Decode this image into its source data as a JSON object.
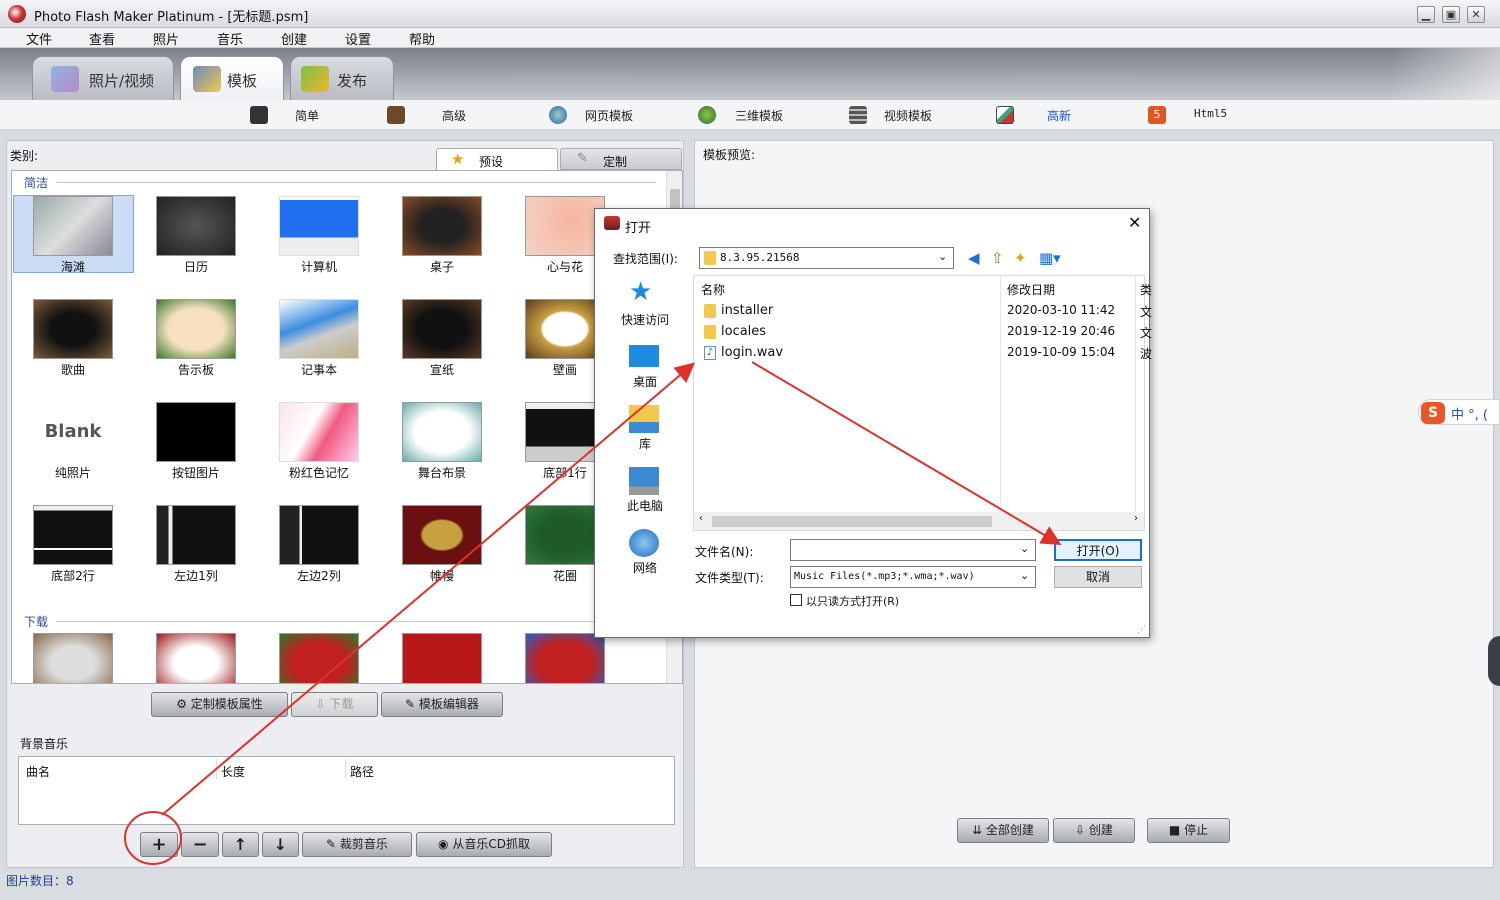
{
  "window": {
    "title": "Photo Flash Maker Platinum - [无标题.psm]",
    "min": "▁",
    "max": "▣",
    "close": "✕"
  },
  "menu": [
    "文件",
    "查看",
    "照片",
    "音乐",
    "创建",
    "设置",
    "帮助"
  ],
  "main_tabs": [
    {
      "label": "照片/视频",
      "icon": "photo-video-icon"
    },
    {
      "label": "模板",
      "icon": "template-icon"
    },
    {
      "label": "发布",
      "icon": "publish-icon"
    }
  ],
  "sub_tabs": [
    {
      "label": "简单",
      "icon": "piano-icon"
    },
    {
      "label": "高级",
      "icon": "briefcase-icon"
    },
    {
      "label": "网页模板",
      "icon": "globe-icon"
    },
    {
      "label": "三维模板",
      "icon": "molecule-icon"
    },
    {
      "label": "视频模板",
      "icon": "film-icon"
    },
    {
      "label": "高新",
      "icon": "picture-icon"
    },
    {
      "label": "Html5",
      "icon": "html5-icon"
    }
  ],
  "left": {
    "category_label": "类别:",
    "preset_tab": "预设",
    "custom_tab": "定制",
    "section_simple": "简洁",
    "section_download": "下载",
    "templates": [
      "海滩",
      "日历",
      "计算机",
      "桌子",
      "心与花",
      "歌曲",
      "告示板",
      "记事本",
      "宣纸",
      "壁画",
      "纯照片",
      "按钮图片",
      "粉红色记忆",
      "舞台布景",
      "底部1行",
      "底部2行",
      "左边1列",
      "左边2列",
      "帷幔",
      "花圈"
    ],
    "blank_text": "Blank",
    "btn_custom_props": "定制模板属性",
    "btn_download": "下载",
    "btn_editor": "模板编辑器",
    "bg_music_label": "背景音乐",
    "music_cols": [
      "曲名",
      "长度",
      "路径"
    ],
    "btn_add": "+",
    "btn_remove": "−",
    "btn_up": "↑",
    "btn_down": "↓",
    "btn_trim": "裁剪音乐",
    "btn_cd": "从音乐CD抓取"
  },
  "right": {
    "preview_label": "模板预览:",
    "btn_build_all": "全部创建",
    "btn_build": "创建",
    "btn_stop": "停止"
  },
  "status": {
    "photo_count": "图片数目：8"
  },
  "ime": {
    "text": "中 °, ("
  },
  "dialog": {
    "title": "打开",
    "lookin_label": "查找范围(I):",
    "lookin_value": "8.3.95.21568",
    "nav": [
      "快速访问",
      "桌面",
      "库",
      "此电脑",
      "网络"
    ],
    "col_name": "名称",
    "col_date": "修改日期",
    "col_extra": "类",
    "files": [
      {
        "name": "installer",
        "date": "2020-03-10 11:42",
        "type": "folder",
        "extra": "文"
      },
      {
        "name": "locales",
        "date": "2019-12-19 20:46",
        "type": "folder",
        "extra": "文"
      },
      {
        "name": "login.wav",
        "date": "2019-10-09 15:04",
        "type": "audio",
        "extra": "波"
      }
    ],
    "filename_label": "文件名(N):",
    "filename_value": "",
    "filetype_label": "文件类型(T):",
    "filetype_value": "Music Files(*.mp3;*.wma;*.wav)",
    "readonly_label": "以只读方式打开(R)",
    "open_btn": "打开(O)",
    "cancel_btn": "取消"
  }
}
